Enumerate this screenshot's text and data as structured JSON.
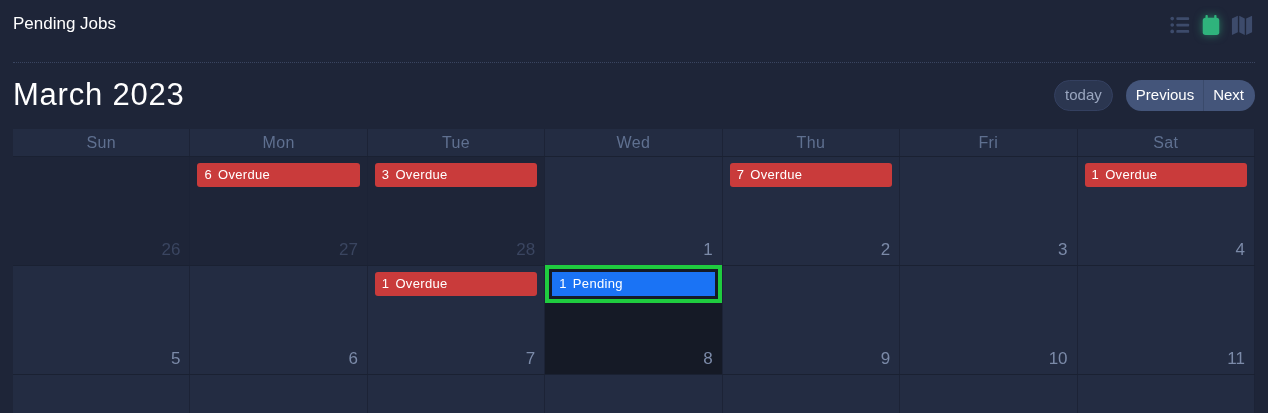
{
  "page_title": "Pending Jobs",
  "views": [
    {
      "kind": "list",
      "selected": false
    },
    {
      "kind": "calendar",
      "selected": true
    },
    {
      "kind": "map",
      "selected": false
    }
  ],
  "month_title": "March 2023",
  "buttons": {
    "today": "today",
    "previous": "Previous",
    "next": "Next"
  },
  "weekdays": [
    "Sun",
    "Mon",
    "Tue",
    "Wed",
    "Thu",
    "Fri",
    "Sat"
  ],
  "weeks": [
    {
      "days": [
        {
          "number": "26",
          "other_month": true,
          "today": false
        },
        {
          "number": "27",
          "other_month": true,
          "today": false,
          "events": [
            {
              "count": "6",
              "label": "Overdue",
              "kind": "overdue",
              "selected": false
            }
          ]
        },
        {
          "number": "28",
          "other_month": true,
          "today": false,
          "events": [
            {
              "count": "3",
              "label": "Overdue",
              "kind": "overdue",
              "selected": false
            }
          ]
        },
        {
          "number": "1",
          "other_month": false,
          "today": false
        },
        {
          "number": "2",
          "other_month": false,
          "today": false,
          "events": [
            {
              "count": "7",
              "label": "Overdue",
              "kind": "overdue",
              "selected": false
            }
          ]
        },
        {
          "number": "3",
          "other_month": false,
          "today": false
        },
        {
          "number": "4",
          "other_month": false,
          "today": false,
          "events": [
            {
              "count": "1",
              "label": "Overdue",
              "kind": "overdue",
              "selected": false
            }
          ]
        }
      ]
    },
    {
      "days": [
        {
          "number": "5",
          "other_month": false,
          "today": false
        },
        {
          "number": "6",
          "other_month": false,
          "today": false
        },
        {
          "number": "7",
          "other_month": false,
          "today": false,
          "events": [
            {
              "count": "1",
              "label": "Overdue",
              "kind": "overdue",
              "selected": false
            }
          ]
        },
        {
          "number": "8",
          "other_month": false,
          "today": true,
          "events": [
            {
              "count": "1",
              "label": "Pending",
              "kind": "pending",
              "selected": true
            }
          ]
        },
        {
          "number": "9",
          "other_month": false,
          "today": false
        },
        {
          "number": "10",
          "other_month": false,
          "today": false
        },
        {
          "number": "11",
          "other_month": false,
          "today": false
        }
      ]
    }
  ]
}
